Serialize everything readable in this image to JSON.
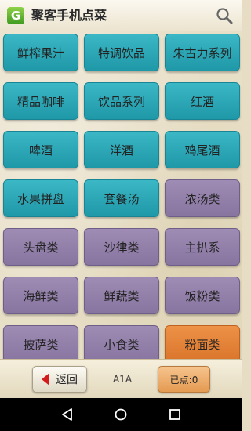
{
  "header": {
    "logo_letter": "G",
    "title": "聚客手机点菜",
    "search_icon": "search-icon"
  },
  "categories": [
    {
      "label": "鲜榨果汁",
      "color": "teal"
    },
    {
      "label": "特调饮品",
      "color": "teal"
    },
    {
      "label": "朱古力系列",
      "color": "teal"
    },
    {
      "label": "精品咖啡",
      "color": "teal"
    },
    {
      "label": "饮品系列",
      "color": "teal"
    },
    {
      "label": "红酒",
      "color": "teal"
    },
    {
      "label": "啤酒",
      "color": "teal"
    },
    {
      "label": "洋酒",
      "color": "teal"
    },
    {
      "label": "鸡尾酒",
      "color": "teal"
    },
    {
      "label": "水果拼盘",
      "color": "teal"
    },
    {
      "label": "套餐汤",
      "color": "teal"
    },
    {
      "label": "浓汤类",
      "color": "purple"
    },
    {
      "label": "头盘类",
      "color": "purple"
    },
    {
      "label": "沙律类",
      "color": "purple"
    },
    {
      "label": "主扒系",
      "color": "purple"
    },
    {
      "label": "海鲜类",
      "color": "purple"
    },
    {
      "label": "鲜蔬类",
      "color": "purple"
    },
    {
      "label": "饭粉类",
      "color": "purple"
    },
    {
      "label": "披萨类",
      "color": "purple"
    },
    {
      "label": "小食类",
      "color": "purple"
    },
    {
      "label": "粉面类",
      "color": "orange"
    }
  ],
  "footer": {
    "back_label": "返回",
    "table_code": "A1A",
    "ordered_label": "已点:0"
  },
  "navbar": {
    "back_icon": "nav-back-icon",
    "home_icon": "nav-home-icon",
    "recents_icon": "nav-recents-icon"
  },
  "colors": {
    "teal": "#2aa7b6",
    "purple": "#9381aa",
    "orange": "#e4843a",
    "back_arrow": "#d21b1b"
  }
}
